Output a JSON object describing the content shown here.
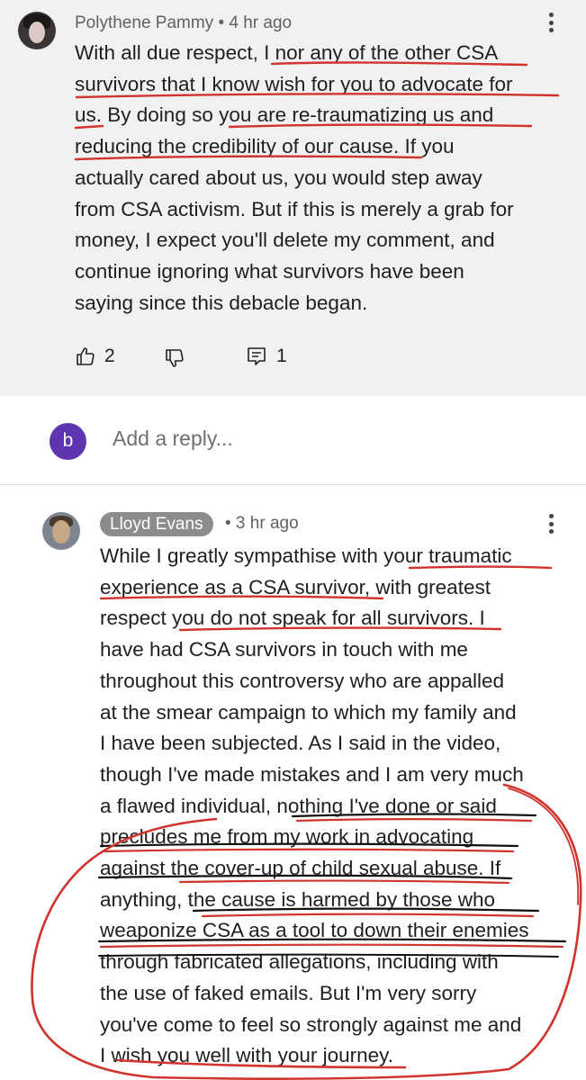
{
  "comment1": {
    "author": "Polythene Pammy",
    "time": "• 4 hr ago",
    "lines": [
      "With all due respect, I nor any of the other CSA",
      "survivors that I know wish for you to advocate for",
      "us. By doing so you are re-traumatizing us and",
      "reducing the credibility of our cause. If you",
      "actually cared about us, you would step away",
      "from CSA activism. But if this is merely a grab for",
      "money,  I expect you'll delete my comment, and",
      "continue ignoring what survivors have been",
      "saying since this debacle began."
    ],
    "likes": "2",
    "replies": "1"
  },
  "reply_box": {
    "avatar_letter": "b",
    "placeholder": "Add a reply..."
  },
  "comment2": {
    "author": "Lloyd Evans",
    "time": "• 3 hr ago",
    "lines": [
      "While I greatly sympathise with your traumatic",
      "experience as a CSA survivor, with greatest",
      "respect you do not speak for all survivors. I",
      "have had CSA survivors in touch with me",
      "throughout this controversy who are appalled",
      "at the smear campaign to which my family and",
      "I have been subjected. As I said in the video,",
      "though I've made mistakes and I am very much",
      "a flawed individual, nothing I've done or said",
      "precludes me from my work in advocating",
      "against the cover-up of child sexual abuse. If",
      "anything, the cause is harmed by those who",
      "weaponize CSA as a tool to down their enemies",
      "through fabricated allegations, including with",
      "the use of faked emails. But I'm very sorry",
      "you've come to feel so strongly against me and",
      "I wish you well with your journey."
    ]
  },
  "colors": {
    "annotation_red": "#d0342c",
    "annotation_black": "#111111",
    "reply_avatar": "#5e35b1"
  }
}
